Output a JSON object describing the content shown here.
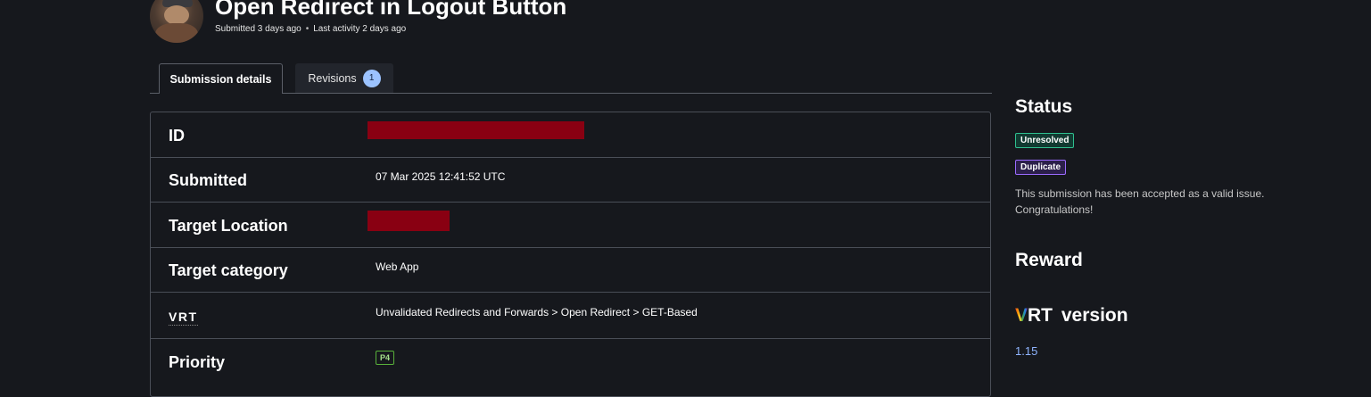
{
  "header": {
    "title": "Open Redirect in Logout Button",
    "submitted": "Submitted 3 days ago",
    "last_activity": "Last activity 2 days ago"
  },
  "tabs": [
    {
      "label": "Submission details",
      "active": true
    },
    {
      "label": "Revisions",
      "badge": "1",
      "active": false
    }
  ],
  "details": {
    "id": {
      "label": "ID"
    },
    "submitted": {
      "label": "Submitted",
      "value": "07 Mar 2025 12:41:52 UTC"
    },
    "target_location": {
      "label": "Target Location"
    },
    "target_category": {
      "label": "Target category",
      "value": "Web App"
    },
    "vrt": {
      "label": "VRT",
      "value": "Unvalidated Redirects and Forwards > Open Redirect > GET-Based"
    },
    "priority": {
      "label": "Priority",
      "value": "P4"
    }
  },
  "sidebar": {
    "status_heading": "Status",
    "status_unresolved": "Unresolved",
    "status_duplicate": "Duplicate",
    "status_message": "This submission has been accepted as a valid issue. Congratulations!",
    "reward_heading": "Reward",
    "vrt_logo_v": "V",
    "vrt_logo_rest": "RT",
    "vrt_version_word": "version",
    "vrt_version_value": "1.15"
  },
  "colors": {
    "background": "#16181d",
    "redaction": "#890012",
    "unresolved": "#2fbf8f",
    "duplicate": "#9b6bff",
    "priority": "#58b03a",
    "link": "#8fb4ff"
  }
}
